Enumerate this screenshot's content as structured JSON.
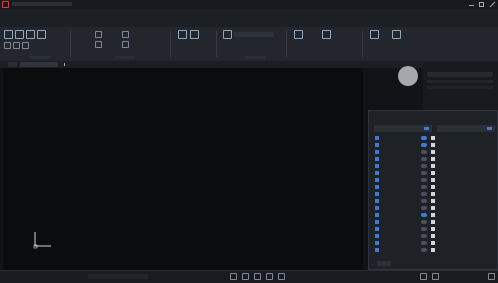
{
  "theme": {
    "accent": "#3d7bd6",
    "background": "#0b0c0e",
    "panel": "#23262c"
  },
  "titlebar": {
    "title": ""
  },
  "menubar": {
    "items": []
  },
  "ribbon": {
    "tabs": [],
    "groups": []
  },
  "document_tabs": {
    "items": []
  },
  "canvas": {
    "ucs_icon": "ucs-icon",
    "nav_wheel_icon": "navigation-wheel-icon"
  },
  "properties_panel": {
    "title": ""
  },
  "layer_dialog": {
    "title": "",
    "selectors": [],
    "rows": [
      {
        "checked": true,
        "toggle": true
      },
      {
        "checked": true,
        "toggle": true
      },
      {
        "checked": true,
        "toggle": false
      },
      {
        "checked": true,
        "toggle": false
      },
      {
        "checked": true,
        "toggle": false
      },
      {
        "checked": true,
        "toggle": false
      },
      {
        "checked": true,
        "toggle": false
      },
      {
        "checked": true,
        "toggle": false
      },
      {
        "checked": true,
        "toggle": false
      },
      {
        "checked": true,
        "toggle": false
      },
      {
        "checked": true,
        "toggle": false
      },
      {
        "checked": true,
        "toggle": true
      },
      {
        "checked": true,
        "toggle": false
      },
      {
        "checked": true,
        "toggle": false
      },
      {
        "checked": true,
        "toggle": false
      },
      {
        "checked": true,
        "toggle": false
      },
      {
        "checked": true,
        "toggle": false
      }
    ]
  },
  "statusbar": {
    "coordinates": "",
    "items": []
  }
}
